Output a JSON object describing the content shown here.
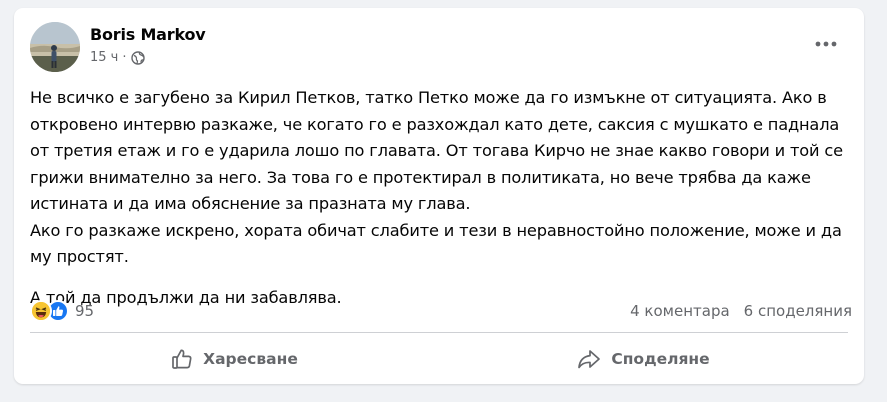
{
  "post": {
    "author": "Boris Markov",
    "time": "15 ч",
    "paragraphs": [
      "Не всичко е загубено за Кирил Петков, татко Петко може да го измъкне от ситуацията. Ако в откровено интервю разкаже, че когато го е разхождал като дете, саксия с мушкато е паднала от третия етаж и го е ударила лошо по главата. От тогава Кирчо не знае какво говори и той се грижи внимателно за него. За това го е протектирал в политиката, но вече трябва да каже истината и да има обяснение за празната му глава.",
      "Ако го разкаже искрено, хората обичат слабите и тези в неравностойно положение, може и да му простят.",
      "А той да продължи да ни забавлява."
    ]
  },
  "stats": {
    "reaction_count": "95",
    "comments": "4 коментара",
    "shares": "6 споделяния"
  },
  "actions": {
    "like": "Харесване",
    "share": "Споделяне"
  },
  "colors": {
    "like_blue": "#1877f2",
    "haha_yellow": "#f7c533",
    "secondary_text": "#65676b"
  },
  "icons": {
    "audience": "globe-icon",
    "more": "more-options-icon",
    "like": "thumbs-up-icon",
    "share": "share-arrow-icon"
  }
}
